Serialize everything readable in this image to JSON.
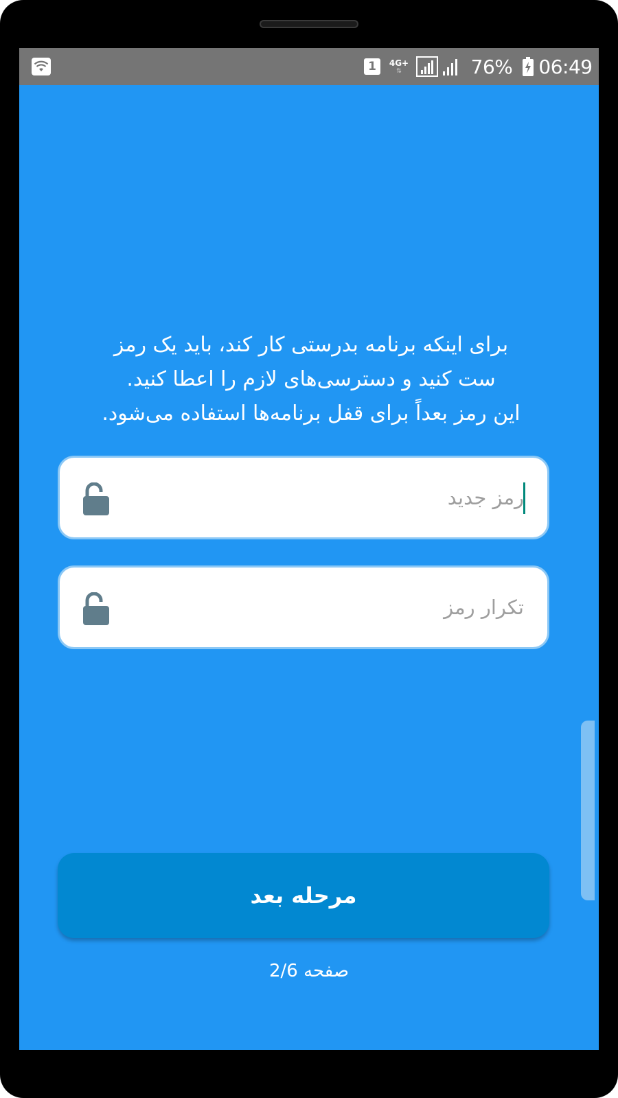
{
  "status_bar": {
    "wifi_icon": "wifi-icon",
    "sim_slot": "1",
    "network_type": "4G+",
    "battery_percent": "76%",
    "time": "06:49"
  },
  "intro": {
    "line1": "برای اینکه برنامه بدرستی کار کند، باید یک رمز",
    "line2": "ست کنید و دسترسی‌های لازم را اعطا کنید.",
    "line3": "این رمز بعداً برای قفل برنامه‌ها استفاده می‌شود."
  },
  "form": {
    "new_password_placeholder": "رمز جدید",
    "repeat_password_placeholder": "تکرار رمز",
    "lock_icon": "lock-open-icon"
  },
  "next_button_label": "مرحله بعد",
  "page_indicator": "صفحه 2/6",
  "colors": {
    "screen_background": "#2196f3",
    "button_background": "#0288d1",
    "status_bar": "#757575",
    "icon": "#607d8b",
    "cursor": "#00897b"
  }
}
